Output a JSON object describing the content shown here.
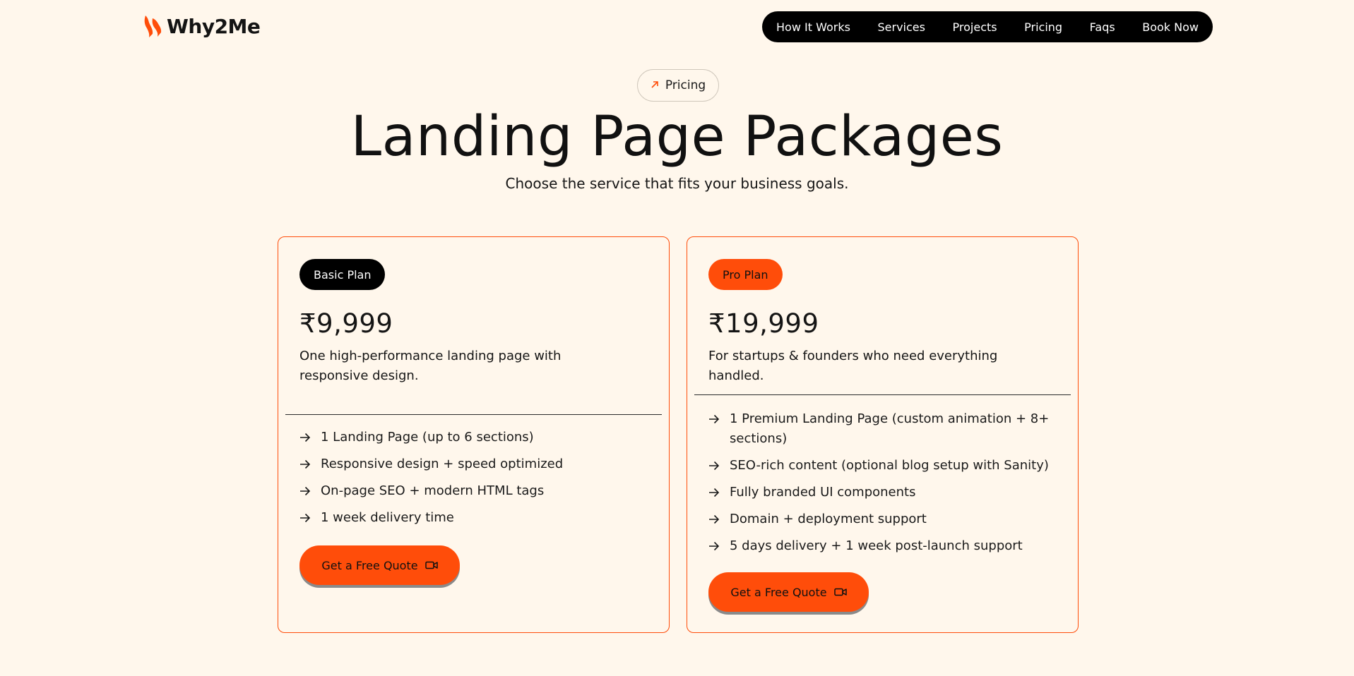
{
  "brand": {
    "name": "Why2Me",
    "accent": "#ff4d0a"
  },
  "nav": {
    "items": [
      "How It Works",
      "Services",
      "Projects",
      "Pricing",
      "Faqs",
      "Book Now"
    ]
  },
  "hero": {
    "pill_label": "Pricing",
    "title": "Landing Page Packages",
    "subtitle": "Choose the service that fits your business goals."
  },
  "plans": [
    {
      "badge": "Basic Plan",
      "price": "₹9,999",
      "description": "One high-performance landing page with responsive design.",
      "features": [
        "1 Landing Page (up to 6 sections)",
        "Responsive design + speed optimized",
        "On-page SEO + modern HTML tags",
        "1 week delivery time"
      ],
      "cta": "Get a Free Quote"
    },
    {
      "badge": "Pro Plan",
      "price": "₹19,999",
      "description": "For startups & founders who need everything handled.",
      "features": [
        "1 Premium Landing Page (custom animation + 8+ sections)",
        "SEO-rich content (optional blog setup with Sanity)",
        "Fully branded UI components",
        "Domain + deployment support",
        "5 days delivery + 1 week post-launch support"
      ],
      "cta": "Get a Free Quote"
    }
  ]
}
